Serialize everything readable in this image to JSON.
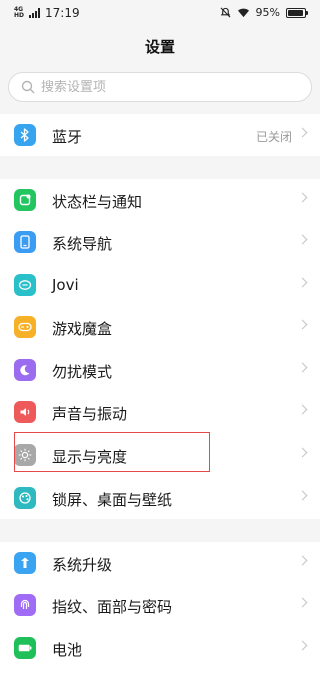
{
  "status_bar": {
    "network": "4G",
    "network_sub": "HD",
    "time": "17:19",
    "battery": "95%",
    "battery_fill": 0.95
  },
  "header": {
    "title": "设置"
  },
  "search": {
    "placeholder": "搜索设置项"
  },
  "groups": [
    {
      "items": [
        {
          "label": "蓝牙",
          "value": "已关闭",
          "icon": "bluetooth-icon",
          "color": "#37a4f0"
        }
      ]
    },
    {
      "items": [
        {
          "label": "状态栏与通知",
          "icon": "notification-icon",
          "color": "#22c55e"
        },
        {
          "label": "系统导航",
          "icon": "navigation-icon",
          "color": "#3b9cf4"
        },
        {
          "label": "Jovi",
          "icon": "jovi-icon",
          "color": "#29c0c9"
        },
        {
          "label": "游戏魔盒",
          "icon": "game-icon",
          "color": "#f7b128"
        },
        {
          "label": "勿扰模式",
          "icon": "moon-icon",
          "color": "#9b6cf0"
        },
        {
          "label": "声音与振动",
          "icon": "sound-icon",
          "color": "#ee5a5a"
        },
        {
          "label": "显示与亮度",
          "icon": "brightness-icon",
          "color": "#a8a8a8"
        },
        {
          "label": "锁屏、桌面与壁纸",
          "icon": "wallpaper-icon",
          "color": "#2eb8c0"
        }
      ]
    },
    {
      "items": [
        {
          "label": "系统升级",
          "icon": "upgrade-icon",
          "color": "#3aa3f2"
        },
        {
          "label": "指纹、面部与密码",
          "icon": "fingerprint-icon",
          "color": "#a06cf5"
        },
        {
          "label": "电池",
          "icon": "battery-icon",
          "color": "#1fbf59"
        }
      ]
    }
  ],
  "colors": {
    "highlight_border": "#e34a4a",
    "background": "#f5f5f5"
  }
}
